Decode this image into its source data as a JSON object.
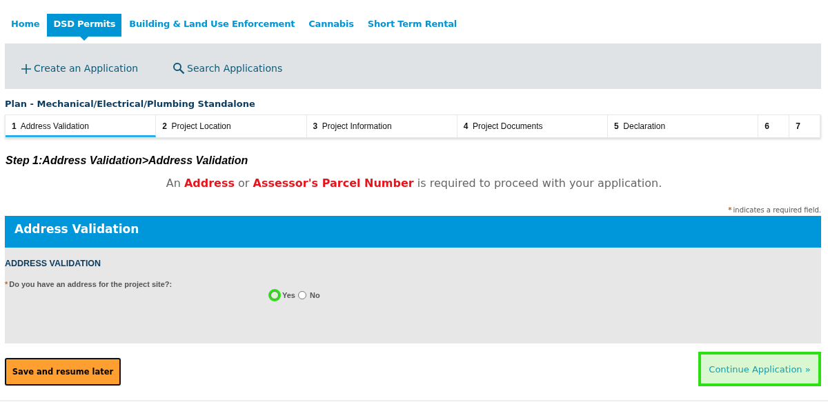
{
  "nav_tabs": [
    {
      "label": "Home",
      "selected": false
    },
    {
      "label": "DSD Permits",
      "selected": true
    },
    {
      "label": "Building & Land Use Enforcement",
      "selected": false
    },
    {
      "label": "Cannabis",
      "selected": false
    },
    {
      "label": "Short Term Rental",
      "selected": false
    }
  ],
  "toolbar": [
    {
      "kind": "create",
      "label": "Create an Application"
    },
    {
      "kind": "search",
      "label": "Search Applications"
    }
  ],
  "record_type": "Plan - Mechanical/Electrical/Plumbing Standalone",
  "steps": [
    {
      "number": "1",
      "label": "Address Validation",
      "selected": true
    },
    {
      "number": "2",
      "label": "Project Location",
      "selected": false
    },
    {
      "number": "3",
      "label": "Project Information",
      "selected": false
    },
    {
      "number": "4",
      "label": "Project Documents",
      "selected": false
    },
    {
      "number": "5",
      "label": "Declaration",
      "selected": false
    },
    {
      "number": "6",
      "selected": false
    },
    {
      "number": "7",
      "selected": false
    }
  ],
  "step_heading": "Step 1:Address Validation>Address Validation",
  "notice": "An **Address** or **Assessor's Parcel Number** is required to proceed with your application.",
  "required_note": {
    "mark": "*",
    "text": "indicates a required field."
  },
  "section": {
    "title": "Address Validation",
    "subtitle": "ADDRESS VALIDATION",
    "question": {
      "mark": "*",
      "label": "Do you have an address for the project site?:",
      "options": [
        {
          "label": "Yes",
          "selected": false,
          "highlighted": true
        },
        {
          "label": "No",
          "selected": false,
          "highlighted": false
        }
      ]
    }
  },
  "buttons": {
    "save": {
      "label": "Save and resume later"
    },
    "continue": {
      "label": "Continue Application »",
      "highlighted": true
    }
  }
}
